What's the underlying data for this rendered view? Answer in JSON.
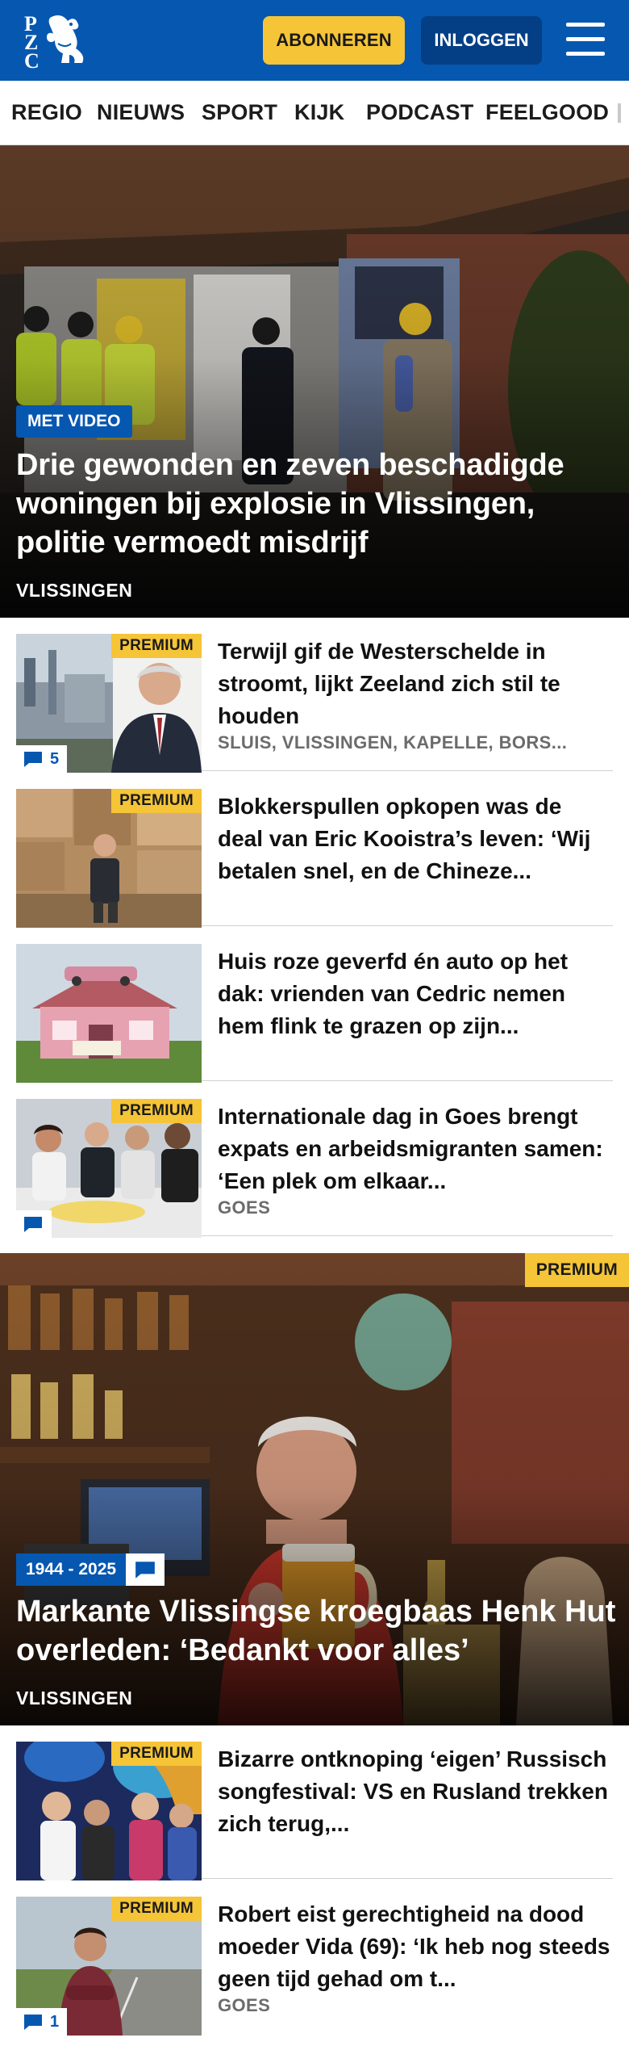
{
  "header": {
    "logo_letters": [
      "P",
      "Z",
      "C"
    ],
    "subscribe_label": "ABONNEREN",
    "login_label": "INLOGGEN",
    "brand_color": "#0657b0",
    "accent_color": "#f5c437"
  },
  "nav": {
    "items": [
      "REGIO",
      "NIEUWS",
      "SPORT",
      "KIJK",
      "PODCAST",
      "FEELGOOD"
    ]
  },
  "hero": {
    "badge": "MET VIDEO",
    "title": "Drie gewonden en zeven beschadigde woningen bij explosie in Vlissingen, politie vermoedt misdrijf",
    "location": "VLISSINGEN"
  },
  "articles": [
    {
      "premium": "PREMIUM",
      "title": "Terwijl gif de Westerschelde in stroomt, lijkt Zeeland zich stil te houden",
      "location": "SLUIS, VLISSINGEN, KAPELLE, BORS...",
      "comments": "5"
    },
    {
      "premium": "PREMIUM",
      "title": "Blokkerspullen opkopen was de deal van Eric Kooistra’s leven: ‘Wij betalen snel, en de Chineze...",
      "location": "",
      "comments": ""
    },
    {
      "premium": "",
      "title": "Huis roze geverfd én auto op het dak: vrienden van Cedric nemen hem flink te grazen op zijn...",
      "location": "",
      "comments": ""
    },
    {
      "premium": "PREMIUM",
      "title": "Internationale dag in Goes brengt expats en arbeidsmigran­ten samen: ‘Een plek om elkaar...",
      "location": "GOES",
      "comments": ""
    }
  ],
  "feature": {
    "premium": "PREMIUM",
    "date_tag": "1944 - 2025",
    "title": "Markante Vlissingse kroegbaas Henk Hut overleden: ‘Bedankt voor alles’",
    "location": "VLISSINGEN"
  },
  "articles2": [
    {
      "premium": "PREMIUM",
      "title": "Bizarre ontknoping ‘eigen’ Russisch songfestival: VS en Rusland trekken zich terug,...",
      "location": "",
      "comments": ""
    },
    {
      "premium": "PREMIUM",
      "title": "Robert eist gerechtigheid na dood moeder Vida (69): ‘Ik heb nog steeds geen tijd gehad om t...",
      "location": "GOES",
      "comments": "1"
    }
  ]
}
